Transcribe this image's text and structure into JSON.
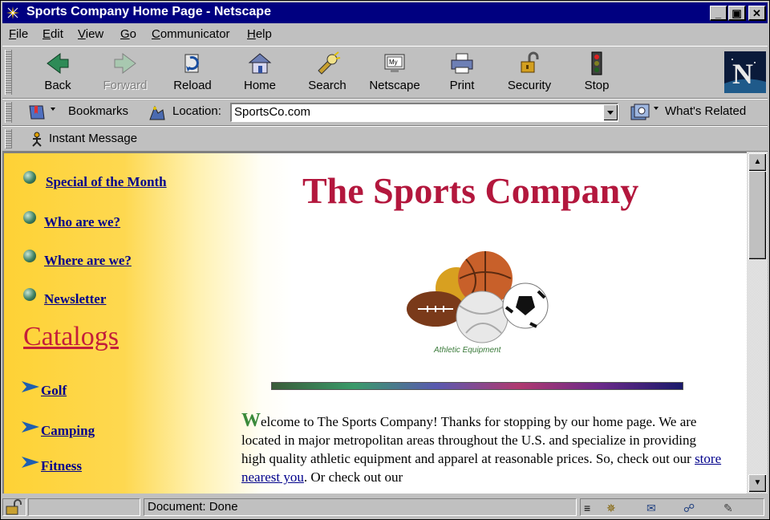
{
  "window": {
    "title": "Sports Company Home Page - Netscape",
    "controls": [
      "minimize",
      "maximize",
      "close"
    ]
  },
  "menu": [
    "File",
    "Edit",
    "View",
    "Go",
    "Communicator",
    "Help"
  ],
  "toolbar": {
    "buttons": [
      {
        "label": "Back",
        "icon": "back-arrow-icon",
        "enabled": true
      },
      {
        "label": "Forward",
        "icon": "forward-arrow-icon",
        "enabled": false
      },
      {
        "label": "Reload",
        "icon": "reload-icon",
        "enabled": true
      },
      {
        "label": "Home",
        "icon": "house-icon",
        "enabled": true
      },
      {
        "label": "Search",
        "icon": "flashlight-icon",
        "enabled": true
      },
      {
        "label": "Netscape",
        "icon": "my-netscape-icon",
        "enabled": true
      },
      {
        "label": "Print",
        "icon": "printer-icon",
        "enabled": true
      },
      {
        "label": "Security",
        "icon": "padlock-icon",
        "enabled": true
      },
      {
        "label": "Stop",
        "icon": "traffic-light-icon",
        "enabled": true
      }
    ]
  },
  "location_bar": {
    "bookmarks_label": "Bookmarks",
    "location_label": "Location:",
    "url": "SportsCo.com",
    "whats_related_label": "What's Related"
  },
  "personal_bar": {
    "instant_message_label": "Instant Message"
  },
  "page": {
    "nav_links": [
      "Special of the Month",
      "Who are we?",
      "Where are we?",
      "Newsletter"
    ],
    "catalogs_heading": "Catalogs",
    "catalog_links": [
      "Golf",
      "Camping",
      "Fitness"
    ],
    "title": "The Sports Company",
    "image_caption": "Athletic Equipment",
    "welcome_dropcap": "W",
    "welcome_text_1": "elcome to The Sports Company! Thanks for stopping by our home page. We are located in major metropolitan areas throughout the U.S. and specialize in providing high quality athletic equipment and apparel at reasonable prices. So, check out our ",
    "welcome_link": "store nearest you",
    "welcome_text_2": ". Or check out our"
  },
  "status_bar": {
    "status_text": "Document: Done"
  },
  "colors": {
    "title_bar": "#000080",
    "page_title": "#b3173d",
    "link": "#00008b",
    "catalogs": "#c41e3a",
    "sidebar_gold": "#fed235"
  }
}
